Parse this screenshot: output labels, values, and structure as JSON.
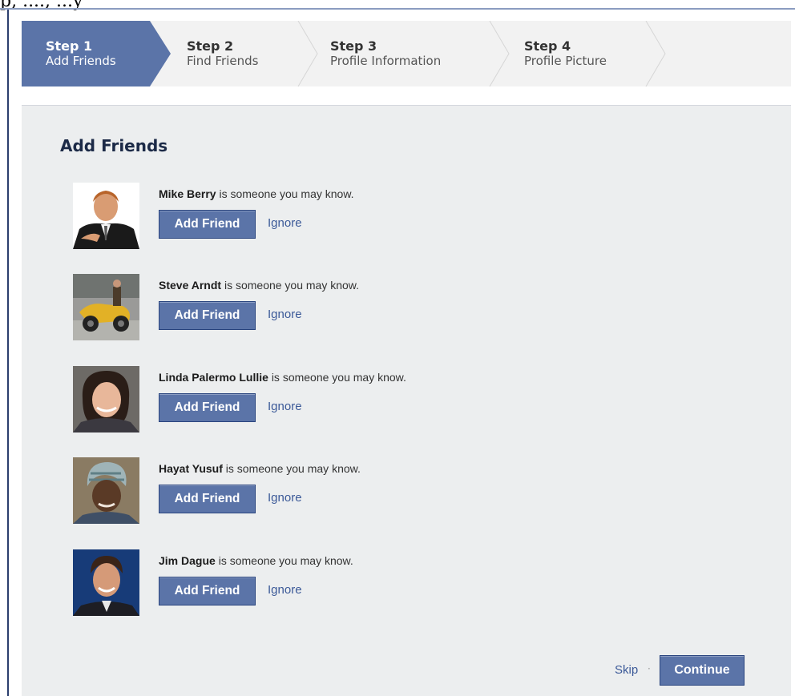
{
  "top_clipped_text": "p, ...., ...y",
  "steps": [
    {
      "num": "Step 1",
      "name": "Add Friends"
    },
    {
      "num": "Step 2",
      "name": "Find Friends"
    },
    {
      "num": "Step 3",
      "name": "Profile Information"
    },
    {
      "num": "Step 4",
      "name": "Profile Picture"
    }
  ],
  "heading": "Add Friends",
  "suffix": "is someone you may know.",
  "add_label": "Add Friend",
  "ignore_label": "Ignore",
  "friends": [
    {
      "name": "Mike Berry",
      "avatar_icon": "person-suit-icon"
    },
    {
      "name": "Steve Arndt",
      "avatar_icon": "motorcycle-photo-icon"
    },
    {
      "name": "Linda Palermo Lullie",
      "avatar_icon": "woman-portrait-icon"
    },
    {
      "name": "Hayat Yusuf",
      "avatar_icon": "woman-headwrap-icon"
    },
    {
      "name": "Jim Dague",
      "avatar_icon": "man-portrait-icon"
    }
  ],
  "footer": {
    "skip": "Skip",
    "dot": "·",
    "continue": "Continue"
  },
  "colors": {
    "accent": "#3b5998",
    "button": "#5b74a8",
    "active_step": "#5b74a8"
  }
}
